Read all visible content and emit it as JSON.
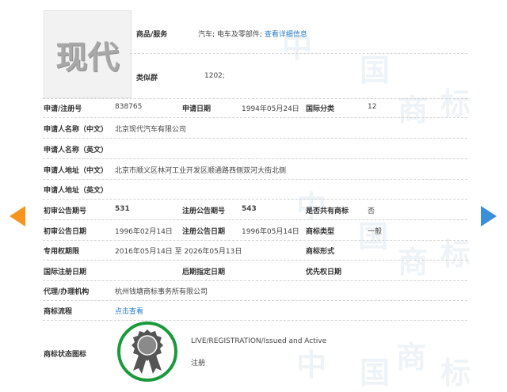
{
  "logo": {
    "text": "现代"
  },
  "goods": {
    "label": "商品/服务",
    "value": "汽车; 电车及零部件;",
    "detail_link": "查看详细信息"
  },
  "similar_group": {
    "label": "类似群",
    "value": "1202;"
  },
  "rows": {
    "reg_no": {
      "label": "申请/注册号",
      "value": "838765"
    },
    "app_date": {
      "label": "申请日期",
      "value": "1994年05月24日"
    },
    "intl_class": {
      "label": "国际分类",
      "value": "12"
    },
    "applicant_cn": {
      "label": "申请人名称（中文）",
      "value": "北京现代汽车有限公司"
    },
    "applicant_en": {
      "label": "申请人名称（英文）",
      "value": ""
    },
    "address_cn": {
      "label": "申请人地址（中文）",
      "value": "北京市顺义区林河工业开发区顺通路西侧双河大街北侧"
    },
    "address_en": {
      "label": "申请人地址（英文）",
      "value": ""
    },
    "prelim_no": {
      "label": "初审公告期号",
      "value": "531"
    },
    "reg_pub_no": {
      "label": "注册公告期号",
      "value": "543"
    },
    "shared": {
      "label": "是否共有商标",
      "value": "否"
    },
    "prelim_date": {
      "label": "初审公告日期",
      "value": "1996年02月14日"
    },
    "reg_pub_date": {
      "label": "注册公告日期",
      "value": "1996年05月14日"
    },
    "tm_type": {
      "label": "商标类型",
      "value": "一般"
    },
    "exclusive": {
      "label": "专用权期限",
      "value": "2016年05月14日 至 2026年05月13日"
    },
    "tm_form": {
      "label": "商标形式",
      "value": ""
    },
    "intl_reg_date": {
      "label": "国际注册日期",
      "value": ""
    },
    "later_date": {
      "label": "后期指定日期",
      "value": ""
    },
    "priority_date": {
      "label": "优先权日期",
      "value": ""
    },
    "agent": {
      "label": "代理/办理机构",
      "value": "杭州钱塘商标事务所有限公司"
    },
    "process": {
      "label": "商标流程",
      "value": "点击查看"
    },
    "status_icon": {
      "label": "商标状态图标"
    }
  },
  "status": {
    "text_en": "LIVE/REGISTRATION/Issued and Active",
    "text_cn": "注册"
  },
  "colors": {
    "accent_blue": "#2a7ecb",
    "arrow_orange": "#f7941d",
    "arrow_blue": "#3b8fd9",
    "status_green": "#1a9a3a"
  }
}
